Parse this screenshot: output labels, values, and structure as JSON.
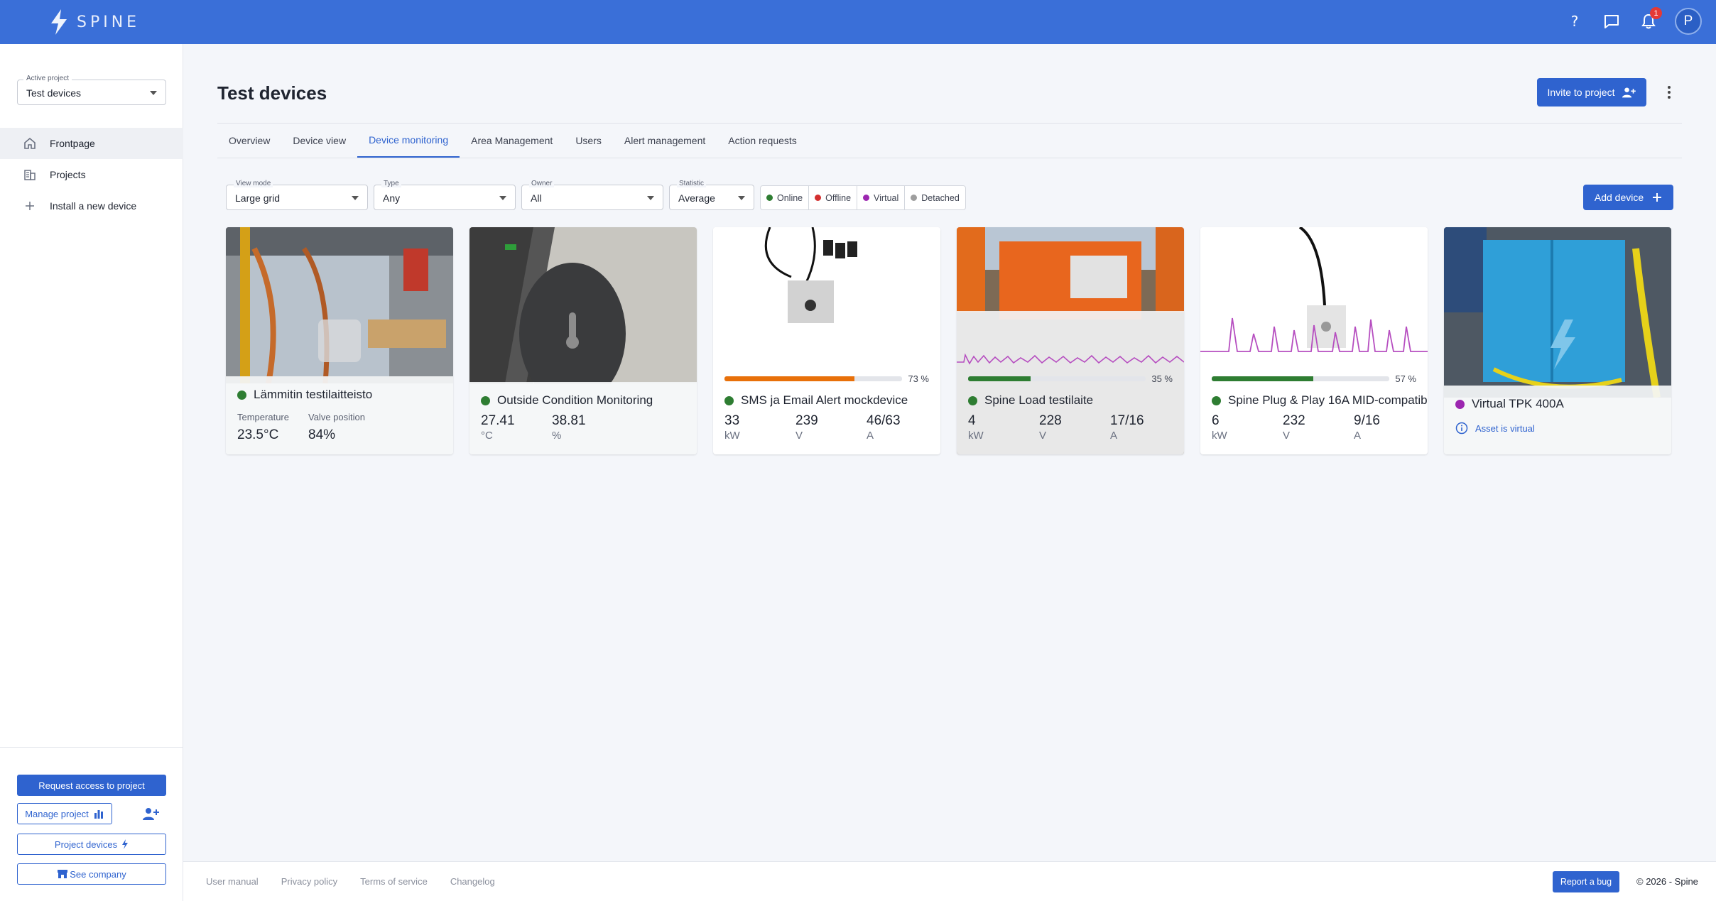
{
  "app": {
    "logo_text": "SPINE"
  },
  "topbar": {
    "help_icon": "help-icon",
    "chat_icon": "chat-icon",
    "notification_count": "1",
    "avatar_initial": "P"
  },
  "sidebar": {
    "active_project_label": "Active project",
    "active_project_value": "Test devices",
    "items": [
      {
        "label": "Frontpage",
        "icon": "home-icon"
      },
      {
        "label": "Projects",
        "icon": "building-icon"
      },
      {
        "label": "Install a new device",
        "icon": "plus-icon"
      }
    ],
    "request_access": "Request access to project",
    "manage_project": "Manage project",
    "project_devices": "Project devices",
    "see_company": "See company"
  },
  "header": {
    "title": "Test devices",
    "invite_label": "Invite to project"
  },
  "tabs": [
    {
      "label": "Overview"
    },
    {
      "label": "Device view"
    },
    {
      "label": "Device monitoring",
      "active": true
    },
    {
      "label": "Area Management"
    },
    {
      "label": "Users"
    },
    {
      "label": "Alert management"
    },
    {
      "label": "Action requests"
    }
  ],
  "filters": {
    "view_mode": {
      "label": "View mode",
      "value": "Large grid"
    },
    "type": {
      "label": "Type",
      "value": "Any"
    },
    "owner": {
      "label": "Owner",
      "value": "All"
    },
    "statistic": {
      "label": "Statistic",
      "value": "Average"
    }
  },
  "legend": [
    {
      "label": "Online",
      "color": "#2e7d32"
    },
    {
      "label": "Offline",
      "color": "#d32f2f"
    },
    {
      "label": "Virtual",
      "color": "#9c27b0"
    },
    {
      "label": "Detached",
      "color": "#9e9e9e"
    }
  ],
  "add_device_label": "Add device",
  "devices": [
    {
      "name": "Lämmitin testilaitteisto",
      "status_color": "#2e7d32",
      "labels": [
        "Temperature",
        "Valve position"
      ],
      "values": [
        "23.5°C",
        "84%"
      ]
    },
    {
      "name": "Outside Condition Monitoring",
      "status_color": "#2e7d32",
      "values": [
        "27.41",
        "38.81"
      ],
      "units": [
        "°C",
        "%"
      ]
    },
    {
      "name": "SMS ja Email Alert mockdevice",
      "status_color": "#2e7d32",
      "progress": 73,
      "progress_text": "73 %",
      "progress_color": "#e8700a",
      "values": [
        "33",
        "239",
        "46/63"
      ],
      "units": [
        "kW",
        "V",
        "A"
      ]
    },
    {
      "name": "Spine Load testilaite",
      "status_color": "#2e7d32",
      "progress": 35,
      "progress_text": "35 %",
      "progress_color": "#2e7d32",
      "values": [
        "4",
        "228",
        "17/16"
      ],
      "units": [
        "kW",
        "V",
        "A"
      ]
    },
    {
      "name": "Spine Plug & Play 16A MID-compatib",
      "status_color": "#2e7d32",
      "progress": 57,
      "progress_text": "57 %",
      "progress_color": "#2e7d32",
      "values": [
        "6",
        "232",
        "9/16"
      ],
      "units": [
        "kW",
        "V",
        "A"
      ]
    },
    {
      "name": "Virtual TPK 400A",
      "status_color": "#9c27b0",
      "note": "Asset is virtual"
    }
  ],
  "footer": {
    "links": [
      "User manual",
      "Privacy policy",
      "Terms of service",
      "Changelog"
    ],
    "report_bug": "Report a bug",
    "copyright": "© 2026 - Spine"
  }
}
